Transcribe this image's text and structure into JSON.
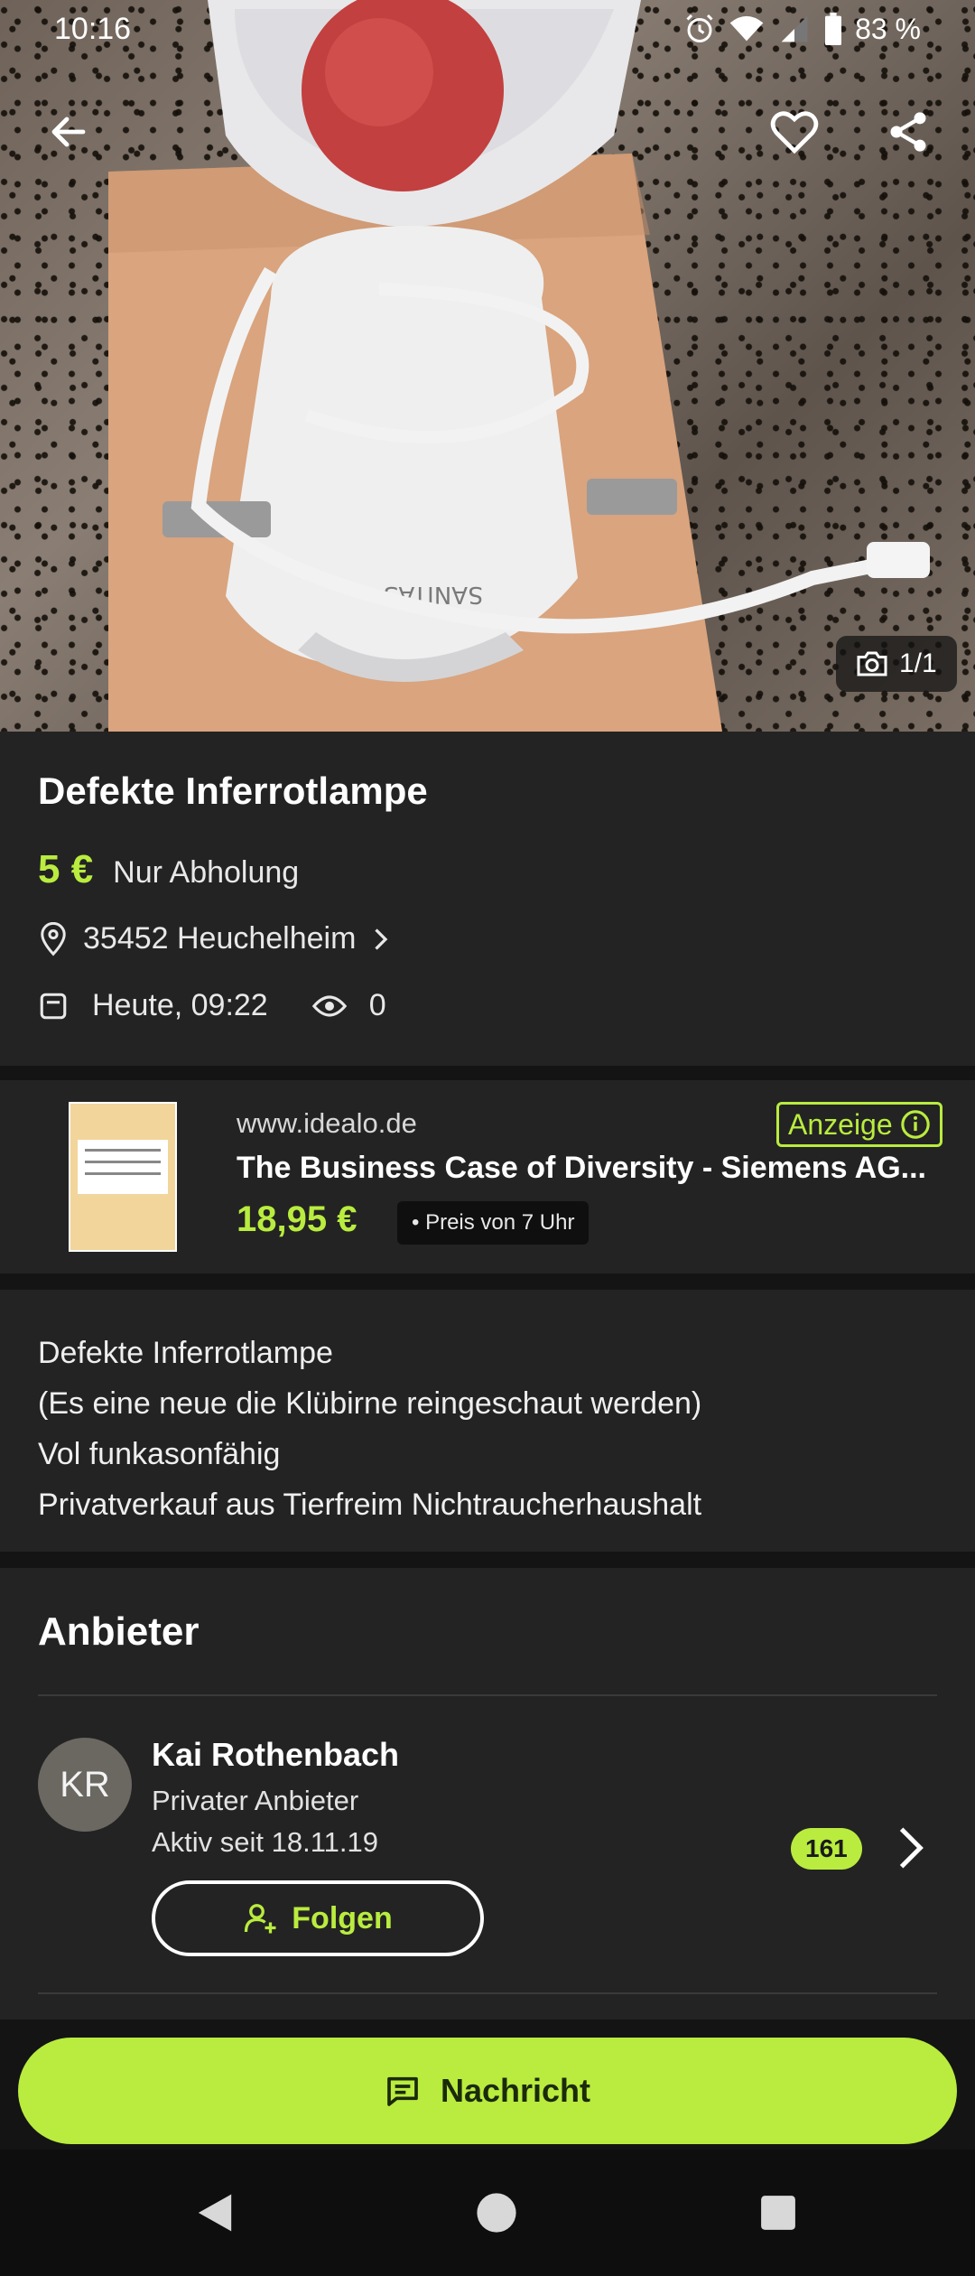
{
  "status_bar": {
    "time": "10:16",
    "battery": "83 %"
  },
  "hero": {
    "photo_counter": "1/1",
    "brand_on_lamp": "SANITAS"
  },
  "listing": {
    "title": "Defekte Inferrotlampe",
    "price": "5 €",
    "pickup": "Nur Abholung",
    "location": "35452 Heuchelheim",
    "date": "Heute, 09:22",
    "views": "0"
  },
  "ad": {
    "domain": "www.idealo.de",
    "label": "Anzeige",
    "title": "The Business Case of Diversity - Siemens AG...",
    "price": "18,95 €",
    "price_note": "• Preis von 7 Uhr"
  },
  "description": {
    "lines": [
      "Defekte Inferrotlampe",
      "(Es eine neue die Klübirne reingeschaut werden)",
      "Vol funkasonfähig",
      "Privatverkauf aus Tierfreim Nichtraucherhaushalt"
    ]
  },
  "seller": {
    "heading": "Anbieter",
    "initials": "KR",
    "name": "Kai Rothenbach",
    "type": "Privater Anbieter",
    "since": "Aktiv seit 18.11.19",
    "rating_count": "161",
    "follow_label": "Folgen"
  },
  "cta": {
    "message_label": "Nachricht"
  },
  "colors": {
    "accent": "#b9ec3f",
    "background": "#141414",
    "surface": "#232323"
  }
}
